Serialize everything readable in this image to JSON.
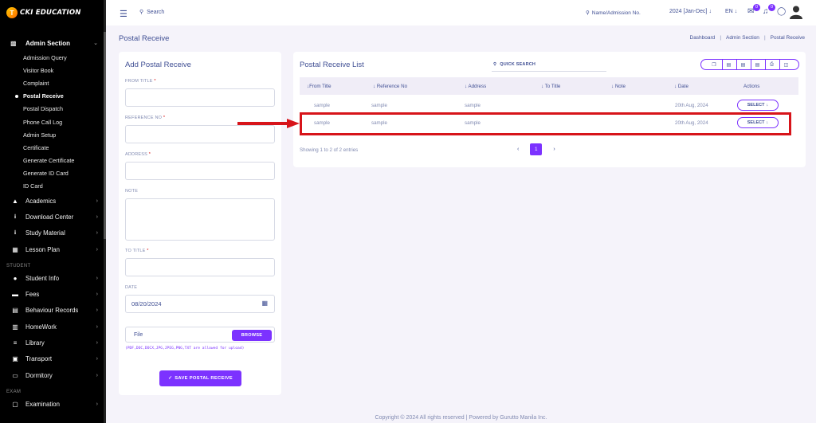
{
  "brand": {
    "logo_text": "CKI EDUCATION",
    "logo_mark": "T"
  },
  "sidebar": {
    "section": {
      "label": "Admin Section",
      "icon": "users-icon"
    },
    "sub_items": [
      "Admission Query",
      "Visitor Book",
      "Complaint",
      "Postal Receive",
      "Postal Dispatch",
      "Phone Call Log",
      "Admin Setup",
      "Certificate",
      "Generate Certificate",
      "Generate ID Card",
      "ID Card"
    ],
    "active_sub": "Postal Receive",
    "items_a": [
      {
        "label": "Academics",
        "icon": "graduation-cap-icon"
      },
      {
        "label": "Download Center",
        "icon": "download-icon"
      },
      {
        "label": "Study Material",
        "icon": "download-icon"
      },
      {
        "label": "Lesson Plan",
        "icon": "calendar-icon"
      }
    ],
    "group_student": "STUDENT",
    "items_b": [
      {
        "label": "Student Info",
        "icon": "user-icon"
      },
      {
        "label": "Fees",
        "icon": "money-icon"
      },
      {
        "label": "Behaviour Records",
        "icon": "clipboard-icon"
      },
      {
        "label": "HomeWork",
        "icon": "book-icon"
      },
      {
        "label": "Library",
        "icon": "library-icon"
      },
      {
        "label": "Transport",
        "icon": "bus-icon"
      },
      {
        "label": "Dormitory",
        "icon": "bed-icon"
      }
    ],
    "group_exam": "EXAM",
    "items_c": [
      {
        "label": "Examination",
        "icon": "exam-icon"
      }
    ]
  },
  "topbar": {
    "search_placeholder": "Search",
    "name_search": "Name/Admission No.",
    "session": "2024 [Jan-Dec]",
    "lang": "EN",
    "badge_messages": "0",
    "badge_notifications": "0"
  },
  "page": {
    "title": "Postal Receive",
    "breadcrumb": [
      "Dashboard",
      "Admin Section",
      "Postal Receive"
    ]
  },
  "form": {
    "title": "Add Postal Receive",
    "from_title_label": "FROM TITLE",
    "reference_label": "REFERENCE NO",
    "address_label": "ADDRESS",
    "note_label": "NOTE",
    "to_title_label": "TO TITLE",
    "date_label": "DATE",
    "date_value": "08/20/2024",
    "required_mark": "*",
    "file_label": "File",
    "browse_label": "BROWSE",
    "file_hint": "(PDF,DOC,DOCX,JPG,JPEG,PNG,TXT are allowed for upload)",
    "save_label": "SAVE POSTAL RECEIVE"
  },
  "list": {
    "title": "Postal Receive List",
    "quick_search": "QUICK SEARCH",
    "columns": [
      "From Title",
      "Reference No",
      "Address",
      "To Title",
      "Note",
      "Date",
      "Actions"
    ],
    "rows": [
      {
        "from_title": "sample",
        "reference": "sample",
        "address": "sample",
        "to_title": "",
        "note": "",
        "date": "20th Aug, 2024",
        "action": "SELECT"
      },
      {
        "from_title": "sample",
        "reference": "sample",
        "address": "sample",
        "to_title": "",
        "note": "",
        "date": "20th Aug, 2024",
        "action": "SELECT"
      }
    ],
    "showing": "Showing 1 to 2 of 2 entries",
    "current_page": "1"
  },
  "footer": "Copyright © 2024 All rights reserved | Powered by Gurutto Manila Inc.",
  "colors": {
    "accent": "#7c32ff",
    "text": "#415094",
    "highlight": "#d7141a"
  }
}
